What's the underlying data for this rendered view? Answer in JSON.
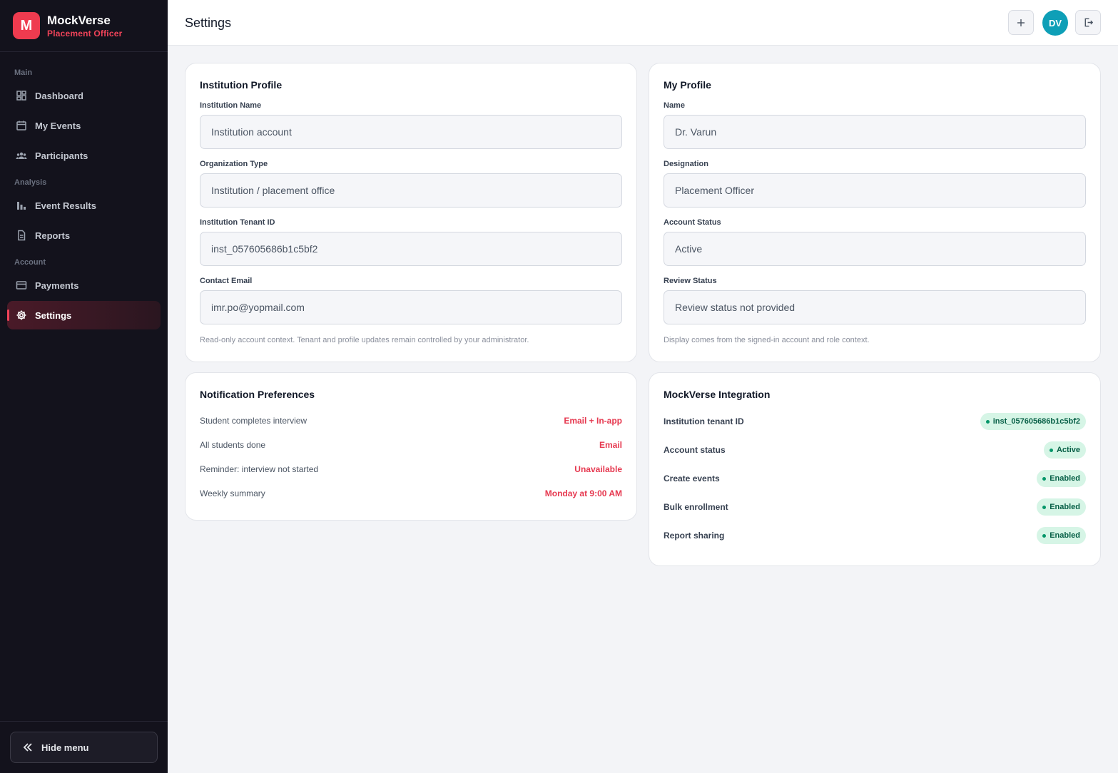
{
  "app": {
    "name": "MockVerse",
    "role": "Placement Officer",
    "logo_letter": "M"
  },
  "sidebar": {
    "sections": [
      {
        "label": "Main"
      },
      {
        "label": "Analysis"
      },
      {
        "label": "Account"
      }
    ],
    "items": [
      {
        "label": "Dashboard",
        "icon": "dashboard-icon"
      },
      {
        "label": "My Events",
        "icon": "calendar-icon"
      },
      {
        "label": "Participants",
        "icon": "people-icon"
      },
      {
        "label": "Event Results",
        "icon": "bar-chart-icon"
      },
      {
        "label": "Reports",
        "icon": "document-icon"
      },
      {
        "label": "Payments",
        "icon": "card-icon"
      },
      {
        "label": "Settings",
        "icon": "gear-icon",
        "active": true
      }
    ],
    "hide_menu": "Hide menu"
  },
  "header": {
    "title": "Settings",
    "avatar_initials": "DV"
  },
  "institution_profile": {
    "title": "Institution Profile",
    "fields": [
      {
        "label": "Institution Name",
        "value": "Institution account"
      },
      {
        "label": "Organization Type",
        "value": "Institution / placement office"
      },
      {
        "label": "Institution Tenant ID",
        "value": "inst_057605686b1c5bf2"
      },
      {
        "label": "Contact Email",
        "value": "imr.po@yopmail.com"
      }
    ],
    "note": "Read-only account context. Tenant and profile updates remain controlled by your administrator."
  },
  "my_profile": {
    "title": "My Profile",
    "fields": [
      {
        "label": "Name",
        "value": "Dr. Varun"
      },
      {
        "label": "Designation",
        "value": "Placement Officer"
      },
      {
        "label": "Account Status",
        "value": "Active"
      },
      {
        "label": "Review Status",
        "value": "Review status not provided"
      }
    ],
    "note": "Display comes from the signed-in account and role context."
  },
  "notifications": {
    "title": "Notification Preferences",
    "rows": [
      {
        "label": "Student completes interview",
        "value": "Email + In-app"
      },
      {
        "label": "All students done",
        "value": "Email"
      },
      {
        "label": "Reminder: interview not started",
        "value": "Unavailable"
      },
      {
        "label": "Weekly summary",
        "value": "Monday at 9:00 AM"
      }
    ]
  },
  "integration": {
    "title": "MockVerse Integration",
    "rows": [
      {
        "label": "Institution tenant ID",
        "value": "inst_057605686b1c5bf2"
      },
      {
        "label": "Account status",
        "value": "Active"
      },
      {
        "label": "Create events",
        "value": "Enabled"
      },
      {
        "label": "Bulk enrollment",
        "value": "Enabled"
      },
      {
        "label": "Report sharing",
        "value": "Enabled"
      }
    ]
  },
  "colors": {
    "accent": "#ef3b4f",
    "sidebar_bg": "#13121c",
    "avatar": "#0e9fb7",
    "badge_bg": "#d6f5e6"
  }
}
